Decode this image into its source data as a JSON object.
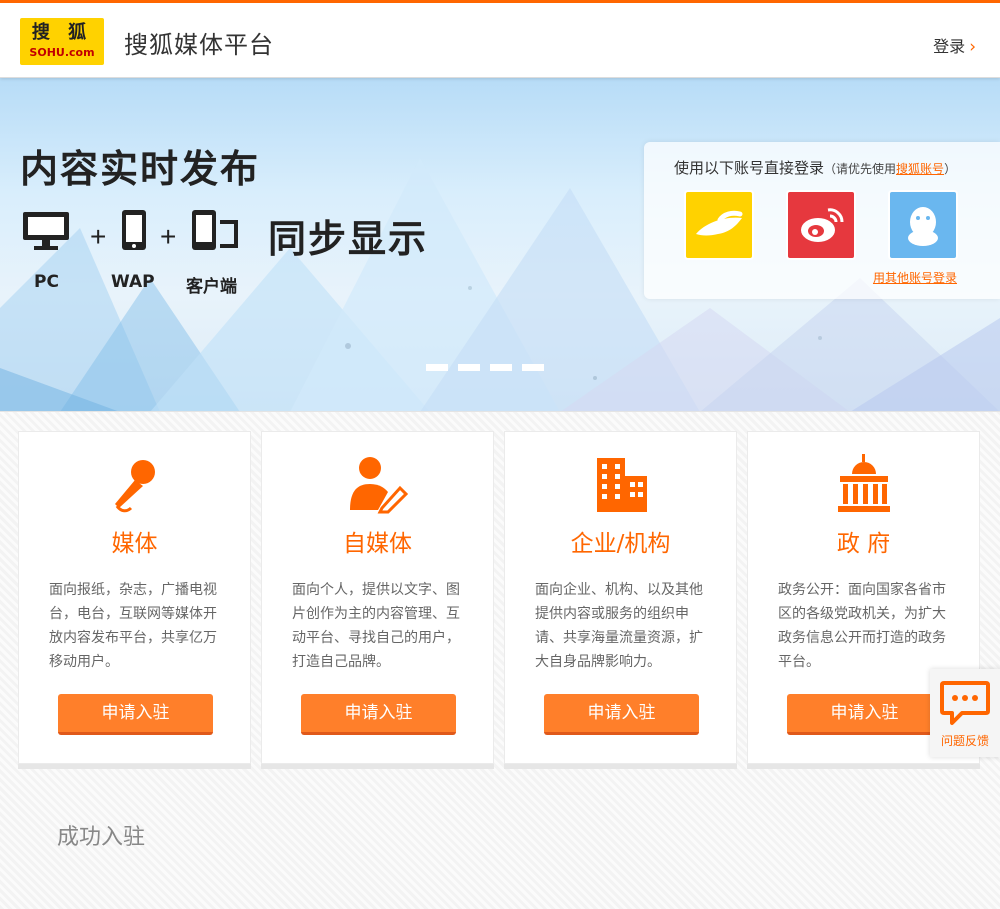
{
  "header": {
    "logo_cn": "搜 狐",
    "logo_en": "SOHU.com",
    "site_title": "搜狐媒体平台",
    "login_label": "登录"
  },
  "hero": {
    "title": "内容实时发布",
    "sync_text": "同步显示",
    "devices": [
      {
        "label": "PC"
      },
      {
        "label": "WAP"
      },
      {
        "label": "客户端"
      }
    ],
    "plus": "+",
    "slide_count": 4
  },
  "login_box": {
    "heading": "使用以下账号直接登录",
    "paren_open": "（",
    "hint": "请优先使用",
    "hint_link": "搜狐账号",
    "paren_close": "）",
    "providers": [
      "sohu-pass",
      "weibo",
      "qq"
    ],
    "other_link": "用其他账号登录"
  },
  "cards": [
    {
      "title": "媒体",
      "desc": "面向报纸，杂志，广播电视台，电台，互联网等媒体开放内容发布平台，共享亿万移动用户。",
      "button": "申请入驻",
      "icon": "microphone-icon"
    },
    {
      "title": "自媒体",
      "desc": "面向个人，提供以文字、图片创作为主的内容管理、互动平台、寻找自己的用户，打造自己品牌。",
      "button": "申请入驻",
      "icon": "person-pen-icon"
    },
    {
      "title": "企业/机构",
      "desc": "面向企业、机构、以及其他提供内容或服务的组织申请、共享海量流量资源，扩大自身品牌影响力。",
      "button": "申请入驻",
      "icon": "buildings-icon"
    },
    {
      "title": "政 府",
      "desc": "政务公开：面向国家各省市区的各级党政机关，为扩大政务信息公开而打造的政务平台。",
      "button": "申请入驻",
      "icon": "government-building-icon"
    }
  ],
  "success_title": "成功入驻",
  "feedback": {
    "label": "问题反馈"
  },
  "colors": {
    "accent": "#ff6600",
    "button": "#ff7f2a",
    "logo_bg": "#ffd200"
  }
}
